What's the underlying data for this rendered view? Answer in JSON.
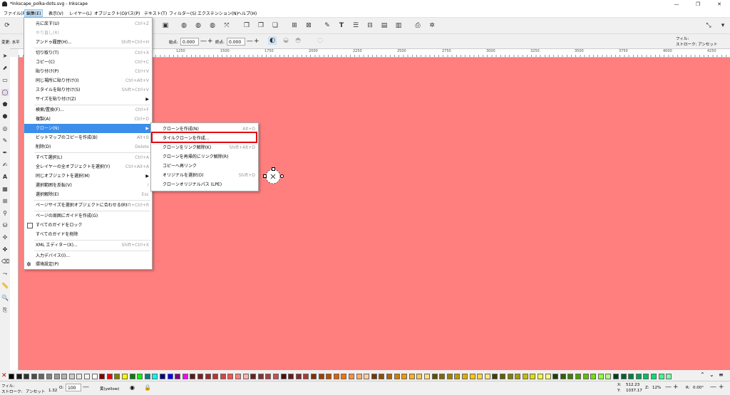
{
  "window": {
    "title": "*Inkscape_polka-dots.svg - Inkscape",
    "minimize": "—",
    "restore": "❐",
    "close": "✕"
  },
  "menubar": [
    "ファイル(F)",
    "編集(E)",
    "表示(V)",
    "レイヤー(L)",
    "オブジェクト(O)",
    "パス(P)",
    "テキスト(T)",
    "フィルター(S)",
    "エクステンション(N)",
    "ヘルプ(H)"
  ],
  "toolbar2": {
    "transform_label": "変更: 水平",
    "width_label": "始点:",
    "width_value": "0.000",
    "end_label": "終点:",
    "end_value": "0.000"
  },
  "fill_stroke_top": {
    "fill": "フィル:",
    "stroke": "ストローク: アンセット"
  },
  "ruler": [
    "1250",
    "1500",
    "1750",
    "2000",
    "2250",
    "2500",
    "2750",
    "3000",
    "3250",
    "3500",
    "3750",
    "4000",
    "4250"
  ],
  "edit_menu": [
    {
      "label": "元に戻す(U)",
      "shortcut": "Ctrl+Z",
      "disabled": false
    },
    {
      "label": "やり直し(R)",
      "shortcut": "",
      "disabled": true
    },
    {
      "label": "アンドゥ履歴(H)...",
      "shortcut": "Shift+Ctrl+H",
      "disabled": false
    },
    {
      "label": "切り取り(T)",
      "shortcut": "Ctrl+X",
      "disabled": false
    },
    {
      "label": "コピー(C)",
      "shortcut": "Ctrl+C",
      "disabled": false
    },
    {
      "label": "貼り付け(P)",
      "shortcut": "Ctrl+V",
      "disabled": false
    },
    {
      "label": "同じ場所に貼り付け(I)",
      "shortcut": "Ctrl+Alt+V",
      "disabled": false
    },
    {
      "label": "スタイルを貼り付け(S)",
      "shortcut": "Shift+Ctrl+V",
      "disabled": false
    },
    {
      "label": "サイズを貼り付け(Z)",
      "shortcut": "",
      "disabled": false
    },
    {
      "label": "検索/置換(F)...",
      "shortcut": "Ctrl+F",
      "disabled": false
    },
    {
      "label": "複製(A)",
      "shortcut": "Ctrl+D",
      "disabled": false
    },
    {
      "label": "クローン(N)",
      "shortcut": "",
      "disabled": false
    },
    {
      "label": "ビットマップのコピーを作成(B)",
      "shortcut": "Alt+B",
      "disabled": false
    },
    {
      "label": "削除(D)",
      "shortcut": "Delete",
      "disabled": false
    },
    {
      "label": "すべて選択(L)",
      "shortcut": "Ctrl+A",
      "disabled": false
    },
    {
      "label": "全レイヤーの全オブジェクトを選択(Y)",
      "shortcut": "Ctrl+Alt+A",
      "disabled": false
    },
    {
      "label": "同じオブジェクトを選択(M)",
      "shortcut": "",
      "disabled": false
    },
    {
      "label": "選択範囲を反転(V)",
      "shortcut": "!",
      "disabled": false
    },
    {
      "label": "選択解除(E)",
      "shortcut": "Esc",
      "disabled": false
    },
    {
      "label": "ページサイズを選択オブジェクトに合わせる(R)",
      "shortcut": "Shift+Ctrl+R",
      "disabled": false
    },
    {
      "label": "ページの周囲にガイドを作成(G)",
      "shortcut": "",
      "disabled": false
    },
    {
      "label": "すべてのガイドをロック",
      "shortcut": "",
      "disabled": false
    },
    {
      "label": "すべてのガイドを削除",
      "shortcut": "",
      "disabled": false
    },
    {
      "label": "XML エディター(X)...",
      "shortcut": "Shift+Ctrl+X",
      "disabled": false
    },
    {
      "label": "入力デバイス(I)...",
      "shortcut": "",
      "disabled": false
    },
    {
      "label": "環境設定(P)",
      "shortcut": "",
      "disabled": false
    }
  ],
  "clone_menu": [
    {
      "label": "クローンを作成(N)",
      "shortcut": "Alt+D"
    },
    {
      "label": "タイルクローンを作成...",
      "shortcut": ""
    },
    {
      "label": "クローンをリンク解除(K)",
      "shortcut": "Shift+Alt+D"
    },
    {
      "label": "クローンを再帰的にリンク解除(R)",
      "shortcut": ""
    },
    {
      "label": "コピーへ再リンク",
      "shortcut": ""
    },
    {
      "label": "オリジナルを選択(O)",
      "shortcut": "Shift+D"
    },
    {
      "label": "クローンオリジナルパス (LPE)",
      "shortcut": ""
    }
  ],
  "statusbar": {
    "fill_label": "フィル:",
    "stroke_label": "ストローク:",
    "stroke_value": "アンセット",
    "stroke_width": "1.32",
    "opacity_label": "O:",
    "opacity_value": "100",
    "layer": "黄(yellow)",
    "x_label": "X:",
    "x_value": "512.23",
    "y_label": "Y:",
    "y_value": "1037.17",
    "zoom_label": "Z:",
    "zoom_value": "12%",
    "rotation_label": "R:",
    "rotation_value": "0.00°"
  },
  "colors": {
    "canvas": "#ff7f7f",
    "highlight": "#3b8ee9",
    "annotation": "#e60012"
  },
  "palette": [
    "#000000",
    "#1a1a1a",
    "#333333",
    "#4d4d4d",
    "#666666",
    "#808080",
    "#999999",
    "#b3b3b3",
    "#cccccc",
    "#e6e6e6",
    "#f2f2f2",
    "#ffffff",
    "#800000",
    "#ff0000",
    "#808000",
    "#ffff00",
    "#008000",
    "#00ff00",
    "#008080",
    "#00ffff",
    "#000080",
    "#0000ff",
    "#800080",
    "#ff00ff",
    "#5a1a1a",
    "#7a2020",
    "#a02828",
    "#c03030",
    "#e04040",
    "#ff5050",
    "#ff8080",
    "#ffb0b0",
    "#6a2020",
    "#8a3030",
    "#aa4040",
    "#ca5050",
    "#4a1010",
    "#6a1a1a",
    "#8a2a2a",
    "#aa3a3a",
    "#803000",
    "#a04000",
    "#c05000",
    "#e06000",
    "#ff7000",
    "#ff9040",
    "#ffb070",
    "#ffd0a0",
    "#703800",
    "#905000",
    "#b06800",
    "#d08000",
    "#f09800",
    "#ffb020",
    "#ffc850",
    "#ffe080",
    "#605000",
    "#806800",
    "#a08000",
    "#c09800",
    "#e0b000",
    "#ffc800",
    "#ffd840",
    "#ffe880",
    "#404000",
    "#606000",
    "#808000",
    "#a0a000",
    "#c0c000",
    "#e0e000",
    "#ffff40",
    "#ffff80",
    "#204000",
    "#306000",
    "#408000",
    "#50a000",
    "#60c000",
    "#70e000",
    "#90ff40",
    "#b0ff80",
    "#004020",
    "#006030",
    "#008040",
    "#00a050",
    "#00c060",
    "#00e070",
    "#40ff90",
    "#80ffb0"
  ]
}
